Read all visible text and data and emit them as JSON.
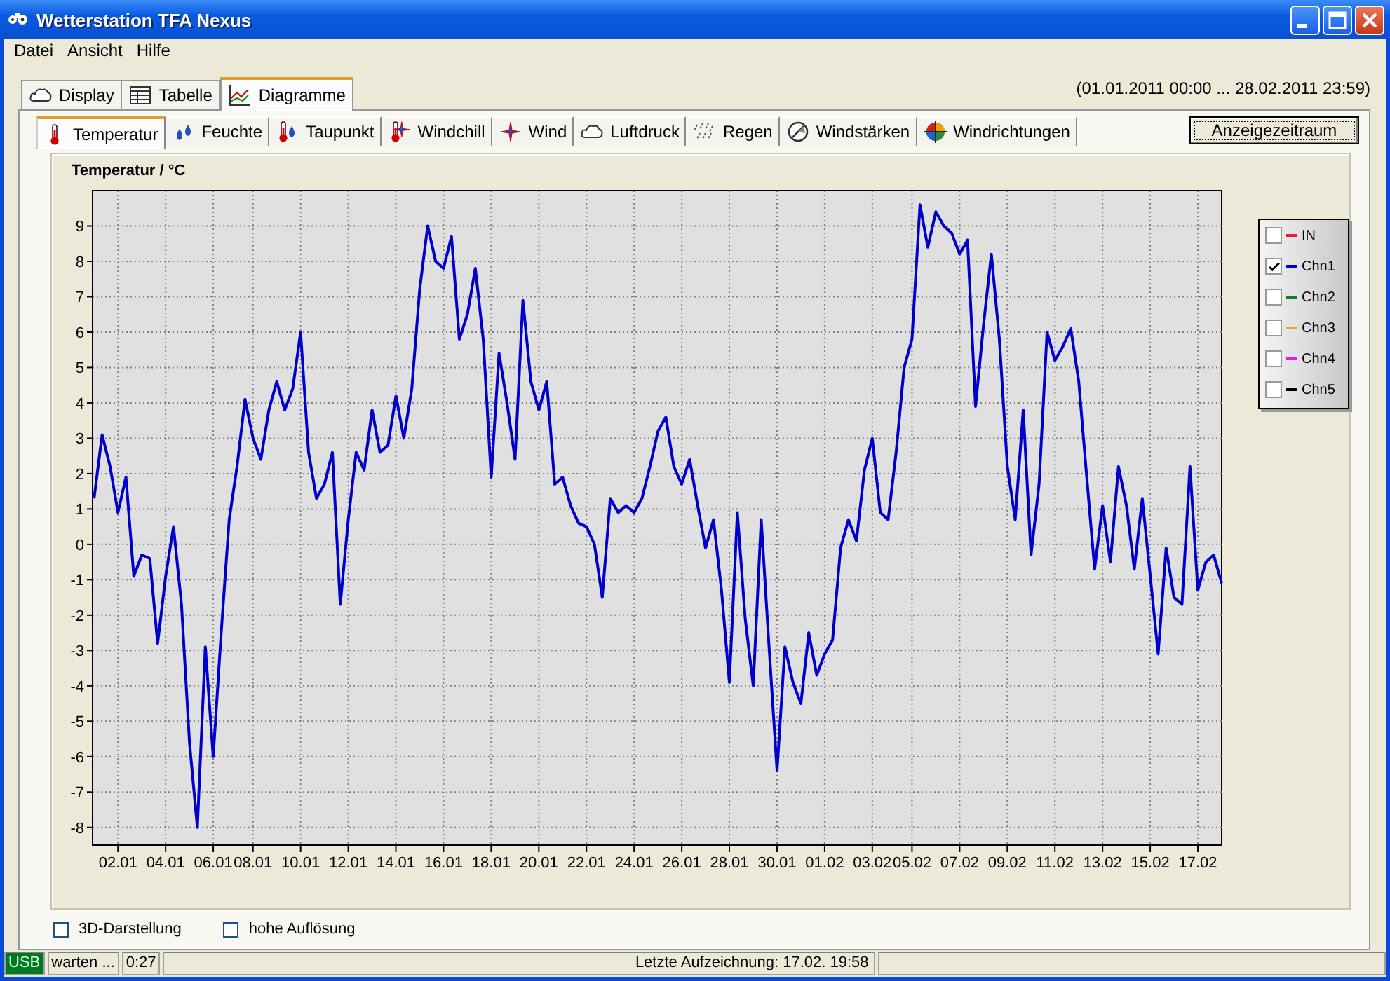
{
  "window": {
    "title": "Wetterstation TFA Nexus"
  },
  "menu": [
    "Datei",
    "Ansicht",
    "Hilfe"
  ],
  "tabs": [
    {
      "label": "Display",
      "selected": false
    },
    {
      "label": "Tabelle",
      "selected": false
    },
    {
      "label": "Diagramme",
      "selected": true
    }
  ],
  "date_range": "(01.01.2011 00:00 ... 28.02.2011 23:59)",
  "subtabs": [
    {
      "label": "Temperatur",
      "selected": true
    },
    {
      "label": "Feuchte",
      "selected": false
    },
    {
      "label": "Taupunkt",
      "selected": false
    },
    {
      "label": "Windchill",
      "selected": false
    },
    {
      "label": "Wind",
      "selected": false
    },
    {
      "label": "Luftdruck",
      "selected": false
    },
    {
      "label": "Regen",
      "selected": false
    },
    {
      "label": "Windstärken",
      "selected": false
    },
    {
      "label": "Windrichtungen",
      "selected": false
    }
  ],
  "period_button": "Anzeigezeitraum",
  "chart": {
    "chart_data": {
      "type": "line",
      "title": "Temperatur / °C",
      "grid": true,
      "ylim": [
        -8.5,
        10
      ],
      "categories": [
        null,
        null,
        null,
        "02.01",
        null,
        null,
        null,
        null,
        null,
        "04.01",
        null,
        null,
        null,
        null,
        null,
        "06.01",
        null,
        null,
        null,
        null,
        "08.01",
        null,
        null,
        null,
        null,
        null,
        "10.01",
        null,
        null,
        null,
        null,
        null,
        "12.01",
        null,
        null,
        null,
        null,
        null,
        "14.01",
        null,
        null,
        null,
        null,
        null,
        "16.01",
        null,
        null,
        null,
        null,
        null,
        "18.01",
        null,
        null,
        null,
        null,
        null,
        "20.01",
        null,
        null,
        null,
        null,
        null,
        "22.01",
        null,
        null,
        null,
        null,
        null,
        "24.01",
        null,
        null,
        null,
        null,
        null,
        "26.01",
        null,
        null,
        null,
        null,
        null,
        "28.01",
        null,
        null,
        null,
        null,
        null,
        "30.01",
        null,
        null,
        null,
        null,
        null,
        "01.02",
        null,
        null,
        null,
        null,
        null,
        "03.02",
        null,
        null,
        null,
        null,
        "05.02",
        null,
        null,
        null,
        null,
        null,
        "07.02",
        null,
        null,
        null,
        null,
        null,
        "09.02",
        null,
        null,
        null,
        null,
        null,
        "11.02",
        null,
        null,
        null,
        null,
        null,
        "13.02",
        null,
        null,
        null,
        null,
        null,
        "15.02",
        null,
        null,
        null,
        null,
        null,
        "17.02",
        null,
        null,
        null
      ],
      "yticks": [
        -8,
        -7,
        -6,
        -5,
        -4,
        -3,
        -2,
        -1,
        0,
        1,
        2,
        3,
        4,
        5,
        6,
        7,
        8,
        9
      ],
      "series": [
        {
          "color": "#0000cc",
          "values": [
            1.3,
            3.1,
            2.2,
            0.9,
            1.9,
            -0.9,
            -0.3,
            -0.4,
            -2.8,
            -0.9,
            0.5,
            -1.7,
            -5.6,
            -8.0,
            -2.9,
            -6.0,
            -2.5,
            0.7,
            2.2,
            4.1,
            3.0,
            2.4,
            3.8,
            4.6,
            3.8,
            4.4,
            6.0,
            2.6,
            1.3,
            1.7,
            2.6,
            -1.7,
            0.7,
            2.6,
            2.1,
            3.8,
            2.6,
            2.8,
            4.2,
            3.0,
            4.4,
            7.2,
            9.0,
            8.0,
            7.8,
            8.7,
            5.8,
            6.5,
            7.8,
            5.8,
            1.9,
            5.4,
            4.0,
            2.4,
            6.9,
            4.6,
            3.8,
            4.6,
            1.7,
            1.9,
            1.1,
            0.6,
            0.5,
            0.0,
            -1.5,
            1.3,
            0.9,
            1.1,
            0.9,
            1.3,
            2.2,
            3.2,
            3.6,
            2.2,
            1.7,
            2.4,
            1.1,
            -0.1,
            0.7,
            -1.3,
            -3.9,
            0.9,
            -2.1,
            -4.0,
            0.7,
            -2.9,
            -6.4,
            -2.9,
            -3.9,
            -4.5,
            -2.5,
            -3.7,
            -3.1,
            -2.7,
            -0.1,
            0.7,
            0.1,
            2.1,
            3.0,
            0.9,
            0.7,
            2.6,
            5.0,
            5.8,
            9.6,
            8.4,
            9.4,
            9.0,
            8.8,
            8.2,
            8.6,
            3.9,
            6.2,
            8.2,
            5.8,
            2.2,
            0.7,
            3.8,
            -0.3,
            1.7,
            6.0,
            5.2,
            5.6,
            6.1,
            4.6,
            1.9,
            -0.7,
            1.1,
            -0.5,
            2.2,
            1.1,
            -0.7,
            1.3,
            -0.9,
            -3.1,
            -0.1,
            -1.5,
            -1.7,
            2.2,
            -1.3,
            -0.5,
            -0.3,
            -1.1
          ]
        }
      ]
    }
  },
  "legend": [
    {
      "label": "IN",
      "color": "#e0203c",
      "checked": false
    },
    {
      "label": "Chn1",
      "color": "#0000cc",
      "checked": true
    },
    {
      "label": "Chn2",
      "color": "#108030",
      "checked": false
    },
    {
      "label": "Chn3",
      "color": "#f0a030",
      "checked": false
    },
    {
      "label": "Chn4",
      "color": "#e020e0",
      "checked": false
    },
    {
      "label": "Chn5",
      "color": "#000000",
      "checked": false
    }
  ],
  "options": [
    {
      "label": "3D-Darstellung",
      "checked": false
    },
    {
      "label": "hohe Auflösung",
      "checked": false
    }
  ],
  "status_bar": {
    "connection": "USB",
    "state": "warten ...",
    "timer": "0:27",
    "last_record": "Letzte Aufzeichnung: 17.02. 19:58"
  }
}
